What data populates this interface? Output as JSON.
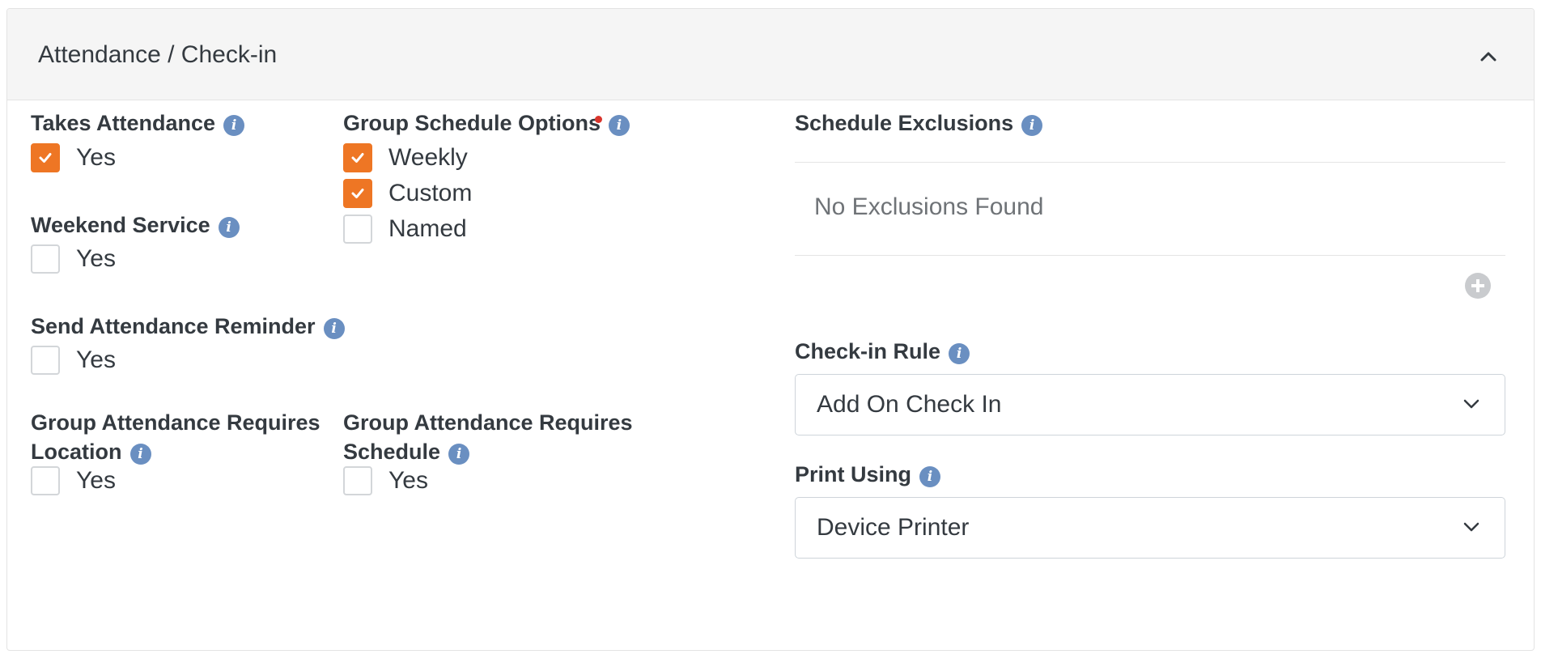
{
  "panel": {
    "title": "Attendance / Check-in"
  },
  "fields": {
    "takes_attendance": {
      "label": "Takes Attendance",
      "option": "Yes",
      "checked": true
    },
    "weekend_service": {
      "label": "Weekend Service",
      "option": "Yes",
      "checked": false
    },
    "send_attendance_reminder": {
      "label": "Send Attendance Reminder",
      "option": "Yes",
      "checked": false
    },
    "requires_location": {
      "label_line1": "Group Attendance Requires",
      "label_line2": "Location",
      "option": "Yes",
      "checked": false
    },
    "requires_schedule": {
      "label_line1": "Group Attendance Requires",
      "label_line2": "Schedule",
      "option": "Yes",
      "checked": false
    },
    "group_schedule_options": {
      "label": "Group Schedule Options",
      "options": [
        {
          "label": "Weekly",
          "checked": true
        },
        {
          "label": "Custom",
          "checked": true
        },
        {
          "label": "Named",
          "checked": false
        }
      ]
    },
    "schedule_exclusions": {
      "label": "Schedule Exclusions",
      "empty_text": "No Exclusions Found"
    },
    "checkin_rule": {
      "label": "Check-in Rule",
      "value": "Add On Check In"
    },
    "print_using": {
      "label": "Print Using",
      "value": "Device Printer"
    }
  },
  "icons": {
    "info": "info-icon",
    "collapse": "chevron-up-icon",
    "add": "plus-circle-icon",
    "dropdown": "chevron-down-icon",
    "check": "checkmark-icon"
  },
  "colors": {
    "accent": "#ee7624",
    "info": "#6a8fc1",
    "required": "#d9352c",
    "header_bg": "#f5f5f5"
  }
}
